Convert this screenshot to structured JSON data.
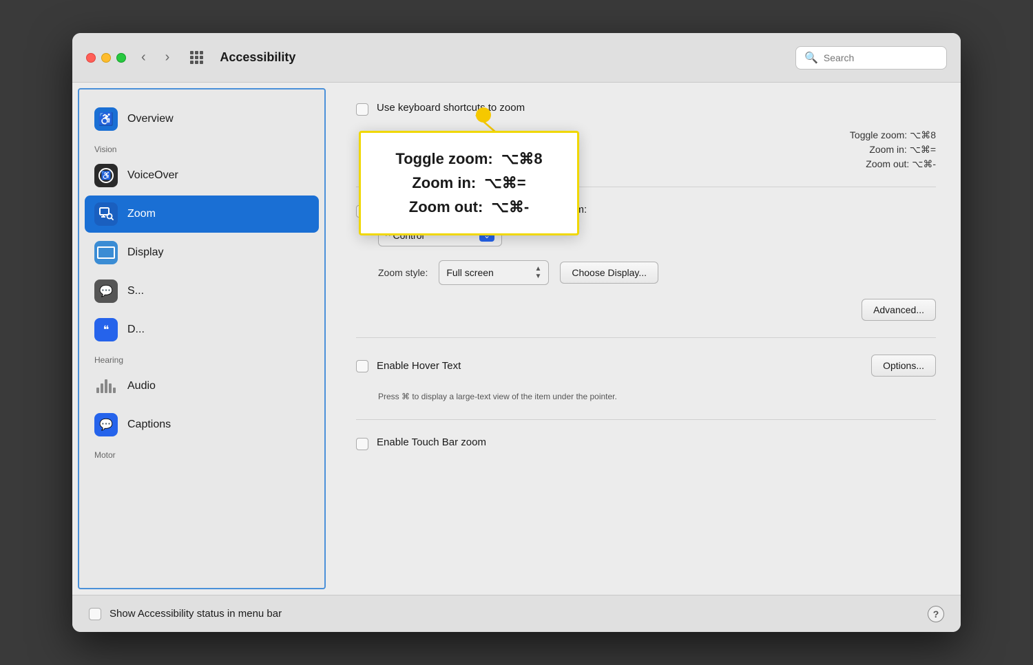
{
  "window": {
    "title": "Accessibility",
    "search_placeholder": "Search"
  },
  "sidebar": {
    "items": [
      {
        "id": "overview",
        "label": "Overview",
        "icon": "accessibility",
        "category": null
      },
      {
        "id": "vision-label",
        "label": "Vision",
        "type": "section"
      },
      {
        "id": "voiceover",
        "label": "VoiceOver",
        "icon": "voiceover",
        "category": "vision"
      },
      {
        "id": "zoom",
        "label": "Zoom",
        "icon": "zoom",
        "category": "vision",
        "active": true
      },
      {
        "id": "display",
        "label": "Display",
        "icon": "display",
        "category": "vision"
      },
      {
        "id": "speech",
        "label": "S...",
        "icon": "speech",
        "category": "vision"
      },
      {
        "id": "descriptions",
        "label": "D...",
        "icon": "descriptions",
        "category": "vision"
      },
      {
        "id": "hearing-label",
        "label": "Hearing",
        "type": "section"
      },
      {
        "id": "audio",
        "label": "Audio",
        "icon": "audio",
        "category": "hearing"
      },
      {
        "id": "captions",
        "label": "Captions",
        "icon": "captions",
        "category": "hearing"
      },
      {
        "id": "motor-label",
        "label": "Motor",
        "type": "section"
      }
    ]
  },
  "main": {
    "use_keyboard_shortcuts_label": "Use keyboard shortcuts to zoom",
    "toggle_zoom_label": "Toggle zoom:",
    "toggle_zoom_shortcut": "⌥⌘8",
    "zoom_in_label": "Zoom in:",
    "zoom_in_shortcut": "⌥⌘=",
    "zoom_out_label": "Zoom out:",
    "zoom_out_shortcut": "⌥⌘-",
    "use_scroll_gesture_label": "Use scroll gesture with modifier keys to zoom:",
    "control_option": "^ Control",
    "zoom_style_label": "Zoom style:",
    "zoom_style_value": "Full screen",
    "choose_display_button": "Choose Display...",
    "advanced_button": "Advanced...",
    "enable_hover_text_label": "Enable Hover Text",
    "options_button": "Options...",
    "hover_text_desc": "Press ⌘ to display a large-text view of the item under the pointer.",
    "enable_touch_bar_zoom_label": "Enable Touch Bar zoom"
  },
  "tooltip": {
    "toggle_zoom": "Toggle zoom:  ⌥⌘8",
    "zoom_in": "Zoom in:  ⌥⌘=",
    "zoom_out": "Zoom out:  ⌥⌘-"
  },
  "bottom": {
    "show_accessibility_label": "Show Accessibility status in menu bar"
  }
}
